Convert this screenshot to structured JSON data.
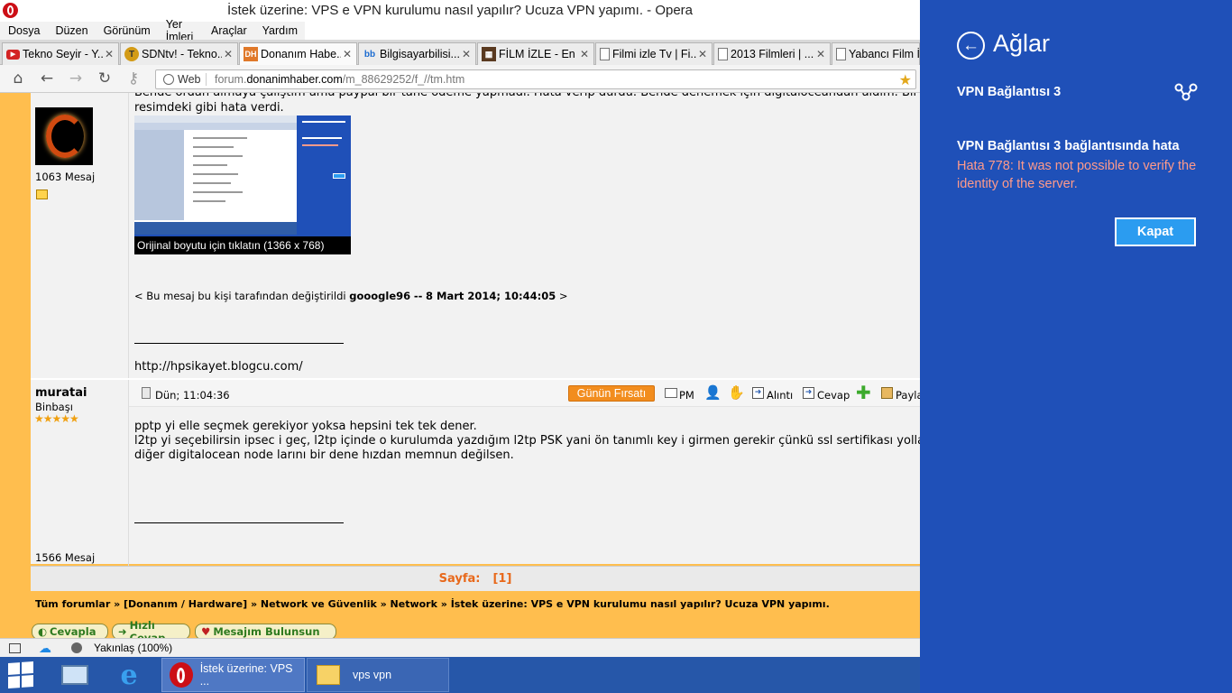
{
  "window": {
    "title": "İstek üzerine: VPS e VPN kurulumu nasıl yapılır? Ucuza VPN yapımı. - Opera"
  },
  "menu": [
    "Dosya",
    "Düzen",
    "Görünüm",
    "Yer İmleri",
    "Araçlar",
    "Yardım"
  ],
  "tabs": [
    {
      "label": "Tekno Seyir - Y...",
      "icon": "youtube-icon"
    },
    {
      "label": "SDNtv! - Tekno...",
      "icon": "sdn-icon"
    },
    {
      "label": "Donanım Habe...",
      "icon": "dh-icon"
    },
    {
      "label": "Bilgisayarbilisi...",
      "icon": "site-icon"
    },
    {
      "label": "FİLM İZLE - En ...",
      "icon": "film-icon"
    },
    {
      "label": "Filmi izle Tv | Fi...",
      "icon": "page-icon"
    },
    {
      "label": "2013 Filmleri | ...",
      "icon": "page-icon"
    },
    {
      "label": "Yabancı Film İz",
      "icon": "page-icon"
    }
  ],
  "address": {
    "web_label": "Web",
    "url_prefix": "forum.",
    "url_domain": "donanimhaber.com",
    "url_path": "/m_88629252/f_//tm.htm"
  },
  "post1": {
    "text_top": "Bende ordan almaya çalıştım ama paypal bir tane ödeme yapmadı. Hata verip durdu. Bende denemek için digitaloceandan aldım. Bir de",
    "text_line2": "resimdeki gibi hata verdi.",
    "post_count": "1063 Mesaj",
    "image_caption": "Orijinal boyutu için tıklatın (1366 x 768)",
    "edit_prefix": "< Bu mesaj bu kişi tarafından değiştirildi",
    "edit_user": "gooogle96",
    "edit_sep": "--",
    "edit_date": "8 Mart 2014; 10:44:05",
    "edit_suffix": ">",
    "signature_url": "http://hpsikayet.blogcu.com/"
  },
  "post2": {
    "username": "muratai",
    "rank": "Binbaşı",
    "stars": "★★★★★",
    "post_count": "1566 Mesaj",
    "time": "Dün; 11:04:36",
    "deal_button": "Günün Fırsatı",
    "actions": {
      "pm": "PM",
      "quote": "Alıntı",
      "reply": "Cevap",
      "share": "Payla"
    },
    "lines": [
      "pptp yi elle seçmek gerekiyor yoksa hepsini tek tek dener.",
      "l2tp yi seçebilirsin ipsec i geç, l2tp içinde o kurulumda yazdığım l2tp PSK yani ön tanımlı key i girmen gerekir çünkü ssl sertifikası yolla",
      "diğer digitalocean node larını bir dene hızdan memnun değilsen."
    ]
  },
  "pager": {
    "label": "Sayfa:",
    "pages": "[1]"
  },
  "breadcrumb": "Tüm forumlar » [Donanım / Hardware] » Network ve Güvenlik » Network » İstek üzerine: VPS e VPN kurulumu nasıl yapılır? Ucuza VPN yapımı.",
  "footer_buttons": {
    "reply": "Cevapla",
    "quick_reply": "Hızlı Cevap",
    "find": "Mesajım Bulunsun"
  },
  "status": {
    "zoom": "Yakınlaş (100%)"
  },
  "taskbar": {
    "opera_item": "İstek üzerine: VPS ...",
    "folder_item": "vps vpn"
  },
  "charm": {
    "title": "Ağlar",
    "connection_name": "VPN Bağlantısı 3",
    "error_title": "VPN Bağlantısı 3 bağlantısında hata",
    "error_message": "Hata 778: It was not possible to verify the identity of the server.",
    "close_button": "Kapat"
  },
  "colors": {
    "charm_bg": "#1f50b8",
    "page_bg": "#ffbe4e",
    "error_text": "#ff9a8a",
    "close_btn": "#2b9cf0",
    "taskbar": "#2657a9"
  }
}
